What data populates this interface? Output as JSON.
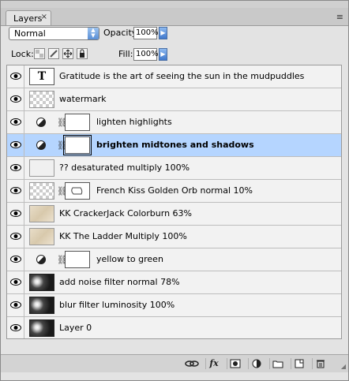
{
  "panel": {
    "tab_label": "Layers",
    "tab_close": "×",
    "collapse_glyph": "◂◂",
    "close_glyph": "×",
    "menu_glyph": "≡"
  },
  "options": {
    "blend_mode": "Normal",
    "opacity_label": "Opacity:",
    "opacity_value": "100%",
    "lock_label": "Lock:",
    "fill_label": "Fill:",
    "fill_value": "100%",
    "step_glyph": "▶"
  },
  "layers": [
    {
      "name": "Gratitude is the art of seeing the sun  in the mudpuddles",
      "type": "text",
      "thumb_glyph": "T",
      "visible": true
    },
    {
      "name": "watermark",
      "type": "pixel",
      "thumb": "checker",
      "visible": true
    },
    {
      "name": "lighten highlights",
      "type": "adjustment",
      "visible": true
    },
    {
      "name": "brighten midtones and shadows",
      "type": "adjustment",
      "visible": true,
      "selected": true
    },
    {
      "name": "?? desaturated multiply 100%",
      "type": "pixel",
      "thumb": "plain",
      "visible": true
    },
    {
      "name": "French Kiss Golden Orb normal 10%",
      "type": "masked-pixel",
      "thumb": "checker",
      "visible": true
    },
    {
      "name": "KK CrackerJack Colorburn 63%",
      "type": "pixel",
      "thumb": "parchment",
      "visible": true
    },
    {
      "name": "KK The Ladder Multiply 100%",
      "type": "pixel",
      "thumb": "parchment",
      "visible": true
    },
    {
      "name": "yellow to green",
      "type": "adjustment",
      "visible": true
    },
    {
      "name": "add noise filter normal 78%",
      "type": "pixel",
      "thumb": "dark",
      "visible": true
    },
    {
      "name": "blur filter luminosity 100%",
      "type": "pixel",
      "thumb": "dark",
      "visible": true
    },
    {
      "name": "Layer 0",
      "type": "pixel",
      "thumb": "dark",
      "visible": true
    }
  ],
  "bottom_bar": {
    "link_icon": "link-layers-icon",
    "fx_label": "fx",
    "mask_icon": "add-mask-icon",
    "adjustment_icon": "new-adjustment-icon",
    "group_icon": "new-group-icon",
    "new_layer_icon": "new-layer-icon",
    "trash_icon": "delete-layer-icon"
  },
  "colors": {
    "selection": "#b5d5ff",
    "accent": "#5a8fd6"
  }
}
